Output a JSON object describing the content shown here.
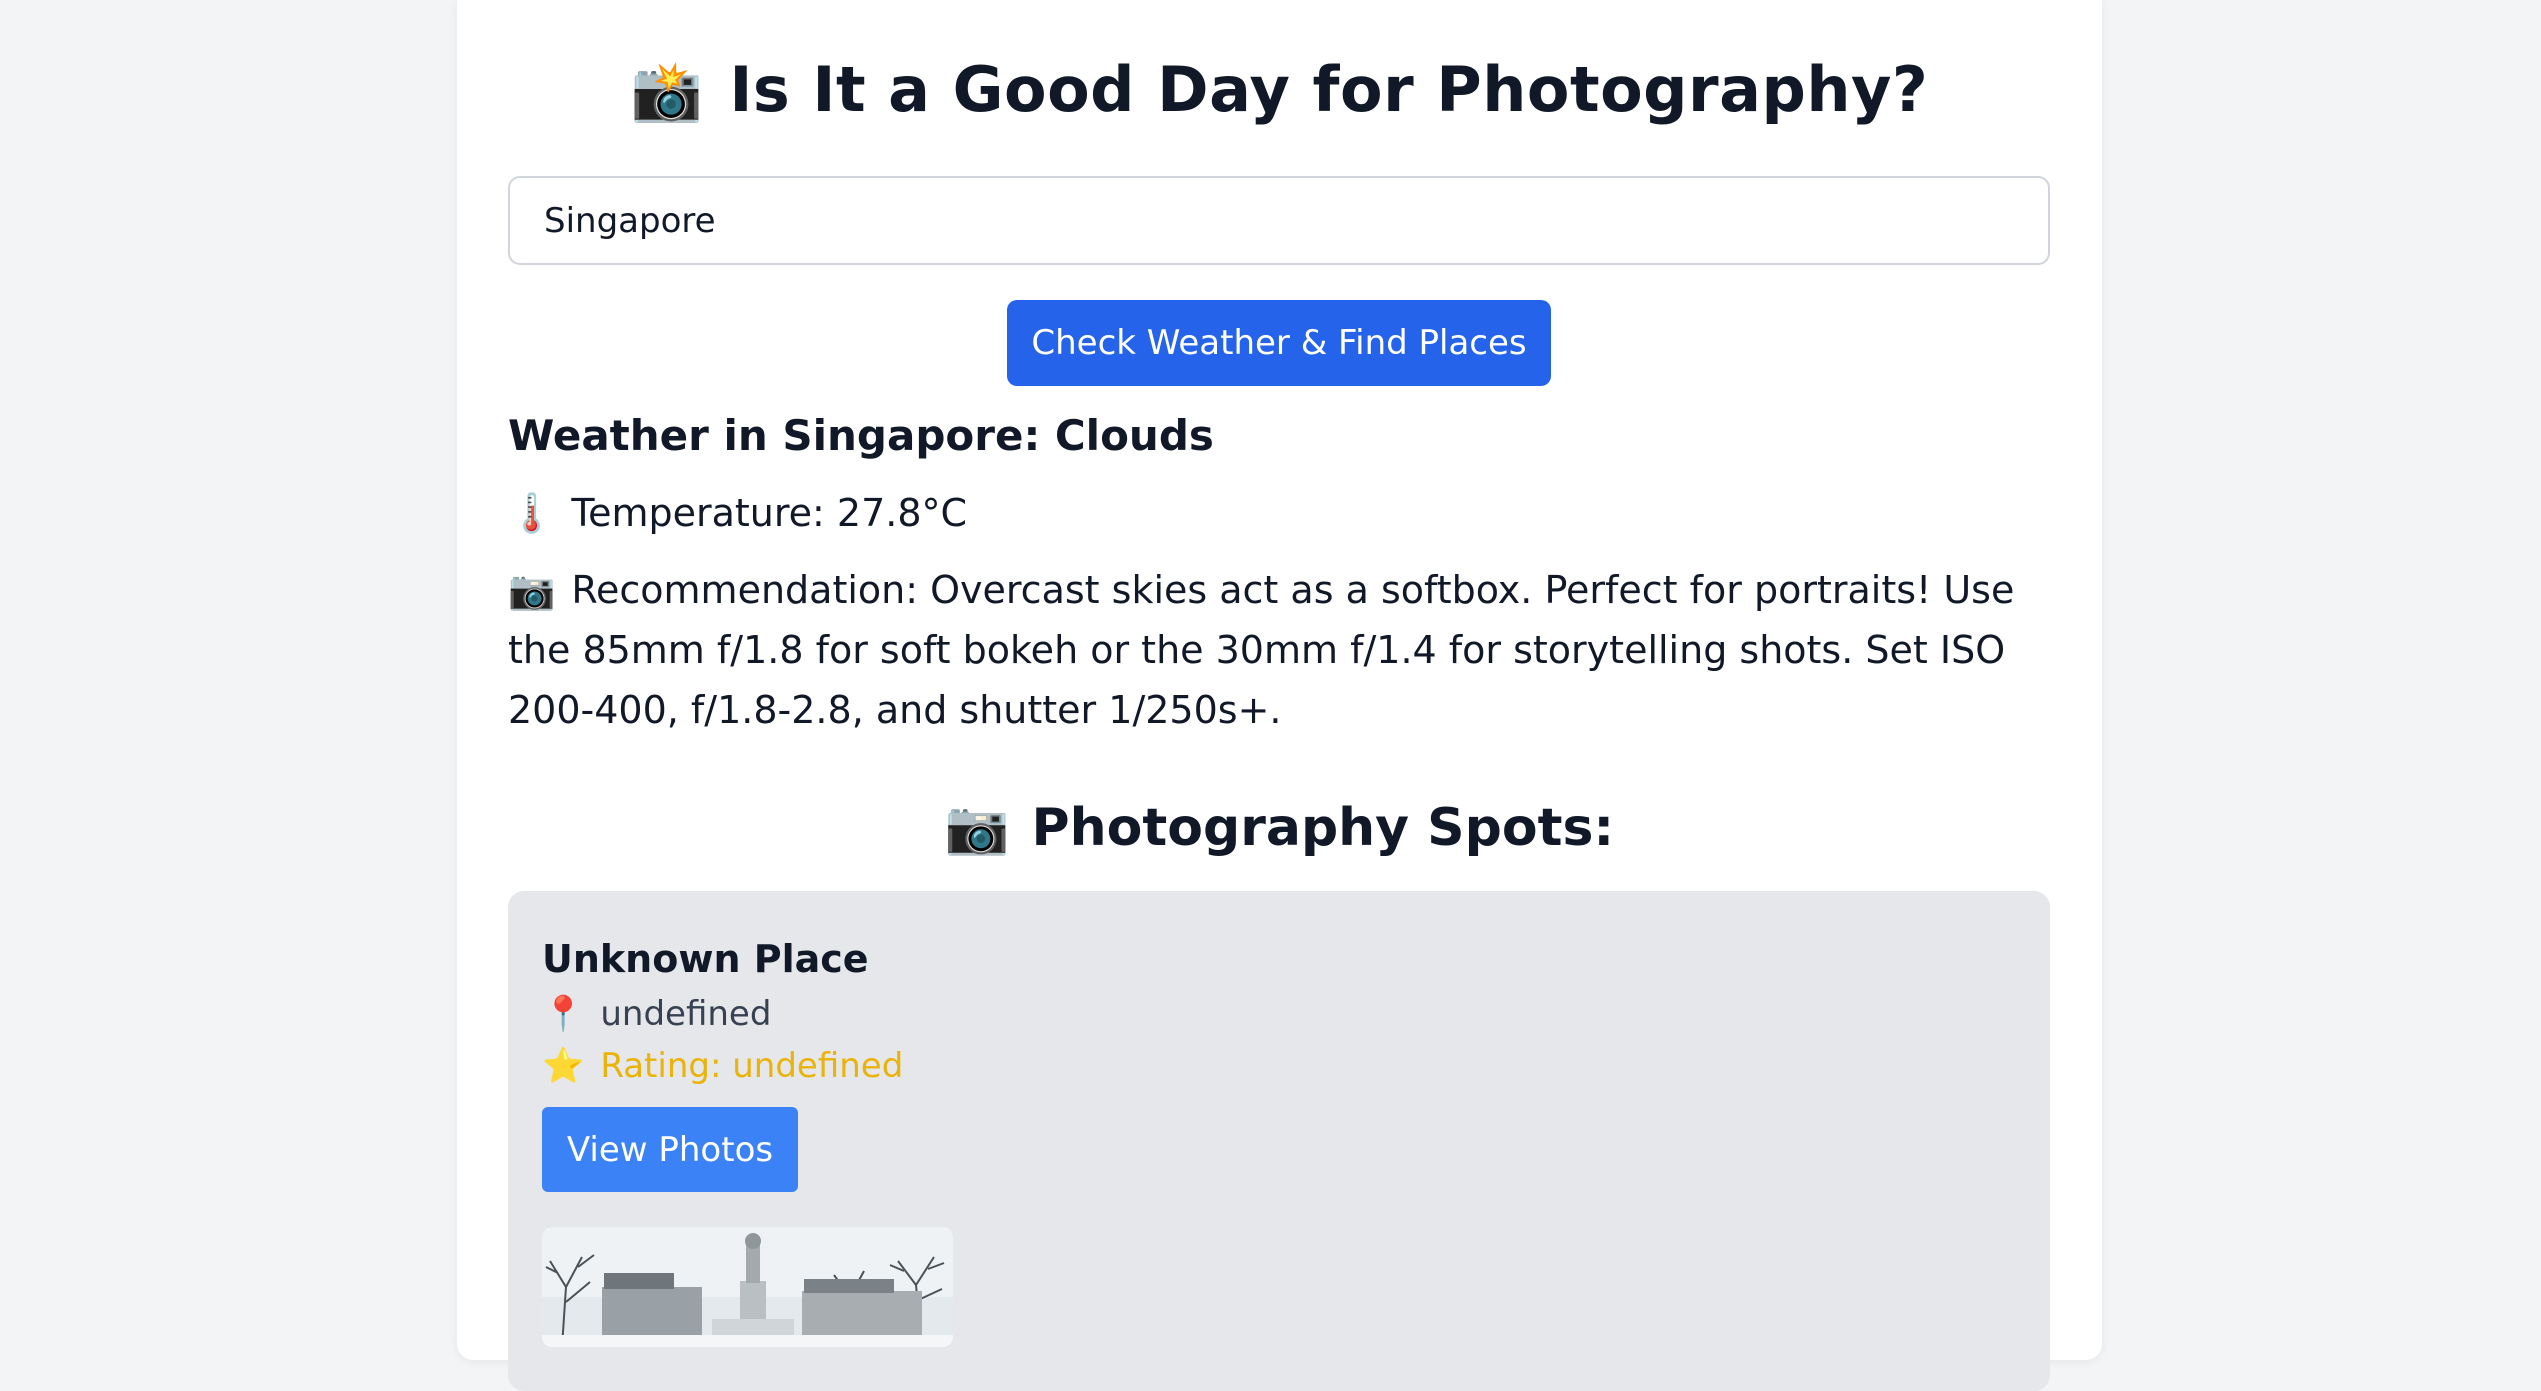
{
  "header": {
    "title_emoji": "📸",
    "title": "Is It a Good Day for Photography?"
  },
  "search": {
    "value": "Singapore"
  },
  "actions": {
    "check_label": "Check Weather & Find Places"
  },
  "weather": {
    "heading": "Weather in Singapore: Clouds",
    "temp_emoji": "🌡️",
    "temperature": "Temperature: 27.8°C",
    "rec_emoji": "📷",
    "recommendation": "Recommendation: Overcast skies act as a softbox. Perfect for portraits! Use the 85mm f/1.8 for soft bokeh or the 30mm f/1.4 for storytelling shots. Set ISO 200-400, f/1.8-2.8, and shutter 1/250s+."
  },
  "spots": {
    "heading_emoji": "📷",
    "heading": "Photography Spots:",
    "places": [
      {
        "name": "Unknown Place",
        "addr_emoji": "📍",
        "address": "undefined",
        "rating_emoji": "⭐",
        "rating": "Rating: undefined",
        "button_label": "View Photos"
      }
    ]
  },
  "colors": {
    "primary_button": "#2563eb",
    "photos_button": "#3b82f6",
    "rating": "#eab308",
    "page_bg": "#f3f4f6",
    "place_bg": "#e5e7eb"
  }
}
